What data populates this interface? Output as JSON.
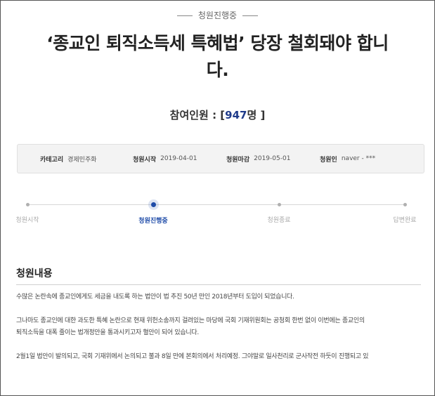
{
  "status": {
    "label": "청원진행중"
  },
  "petition": {
    "title_line1": "‘종교인 퇴직소득세 특혜법’ 당장 철회돼야 합니",
    "title_line2": "다."
  },
  "participants": {
    "label": "참여인원 : [",
    "count": "947",
    "unit": "명 ]"
  },
  "info": {
    "category_label": "카테고리",
    "category_value": "경제민주화",
    "start_label": "청원시작",
    "start_value": "2019-04-01",
    "end_label": "청원마감",
    "end_value": "2019-05-01",
    "author_label": "청원인",
    "author_value": "naver - ***"
  },
  "progress": {
    "steps": [
      {
        "label": "청원시작"
      },
      {
        "label": "청원진행중"
      },
      {
        "label": "청원종료"
      },
      {
        "label": "답변완료"
      }
    ],
    "current_step_index": 1
  },
  "content": {
    "heading": "청원내용",
    "p1": "수많은 논란속에 종교인에게도 세금을 내도록 하는 법안이 법 추진 50년 만인 2018년부터 도입이 되었습니다.",
    "p2a": "그나마도 종교인에 대한 과도한 특혜 논란으로 현재 위헌소송까지 걸려있는 마당에 국회 기재위원회는 공청회 한번 없이 이번에는 종교인의",
    "p2b": "퇴직소득을 대폭 줄이는 법개정안을 통과시키고자 혈안이 되어 있습니다.",
    "p3": "2월1일 법안이 발의되고, 국회 기재위에서 논의되고 불과 8일 만에 본회의에서 처리예정. 그야말로 일사천리로 군사작전 하듯이 진행되고 있"
  }
}
